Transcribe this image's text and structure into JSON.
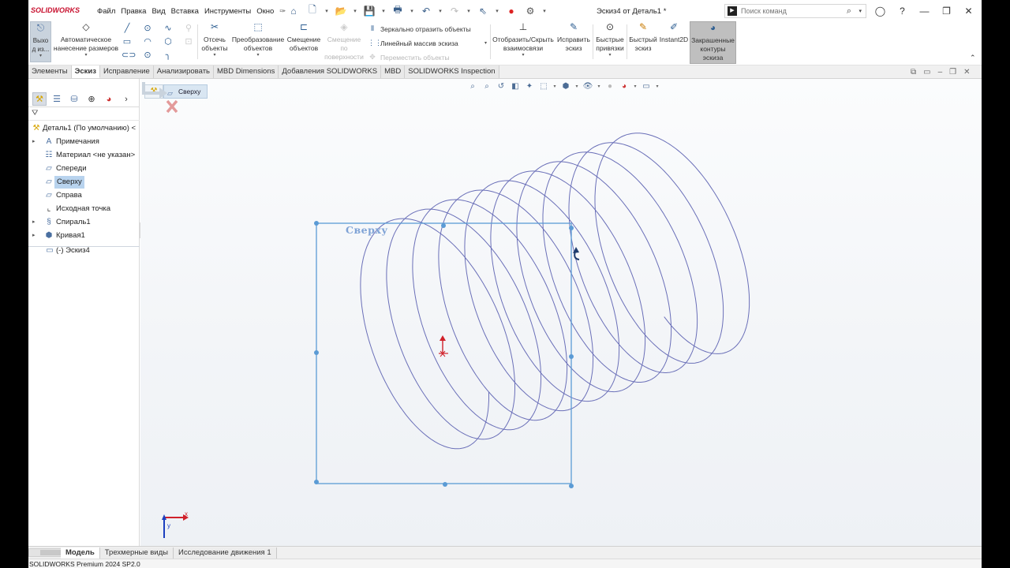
{
  "app": {
    "logo_text": "SOLIDWORKS",
    "document_title": "Эскиз4 от Деталь1 *"
  },
  "menu": [
    "Файл",
    "Правка",
    "Вид",
    "Вставка",
    "Инструменты",
    "Окно"
  ],
  "search": {
    "placeholder": "Поиск команд"
  },
  "ribbon": {
    "exit_label": "Выхо\nд из...",
    "auto_dim": "Автоматическое\nнанесение размеров",
    "trim": "Отсечь\nобъекты",
    "convert": "Преобразование\nобъектов",
    "offset": "Смещение\nобъектов",
    "offset_surface": "Смещение\nпо\nповерхности",
    "mirror": "Зеркально отразить объекты",
    "linear_array": "Линейный массив эскиза",
    "move": "Переместить объекты",
    "show_hide_rel": "Отобразить/Скрыть\nвзаимосвязи",
    "repair": "Исправить\nэскиз",
    "quick_snaps": "Быстрые\nпривязки",
    "rapid_sketch": "Быстрый\nэскиз",
    "instant2d": "Instant2D",
    "shaded_contours": "Закрашенные\nконтуры\nэскиза"
  },
  "tabs": [
    "Элементы",
    "Эскиз",
    "Исправление",
    "Анализировать",
    "MBD Dimensions",
    "Добавления SOLIDWORKS",
    "MBD",
    "SOLIDWORKS Inspection"
  ],
  "active_tab": "Эскиз",
  "tree": {
    "root": "Деталь1 (По умолчанию) <",
    "items": [
      {
        "label": "Примечания",
        "icon": "annotations-icon",
        "expandable": true
      },
      {
        "label": "Материал <не указан>",
        "icon": "material-icon",
        "expandable": false
      },
      {
        "label": "Спереди",
        "icon": "plane-icon",
        "expandable": false
      },
      {
        "label": "Сверху",
        "icon": "plane-icon",
        "expandable": false,
        "selected": true
      },
      {
        "label": "Справа",
        "icon": "plane-icon",
        "expandable": false
      },
      {
        "label": "Исходная точка",
        "icon": "origin-icon",
        "expandable": false
      },
      {
        "label": "Спираль1",
        "icon": "helix-icon",
        "expandable": true
      },
      {
        "label": "Кривая1",
        "icon": "curve-icon",
        "expandable": true
      }
    ],
    "active_sketch": "(-) Эскиз4"
  },
  "graphics": {
    "breadcrumb": "Сверху",
    "plane_label": "Сверху",
    "sketch_color": "#5b9bd5",
    "helix_color": "#6a6fb8"
  },
  "bottom_tabs": [
    "Модель",
    "Трехмерные виды",
    "Исследование движения 1"
  ],
  "active_bottom_tab": "Модель",
  "status": "SOLIDWORKS Premium 2024 SP2.0"
}
